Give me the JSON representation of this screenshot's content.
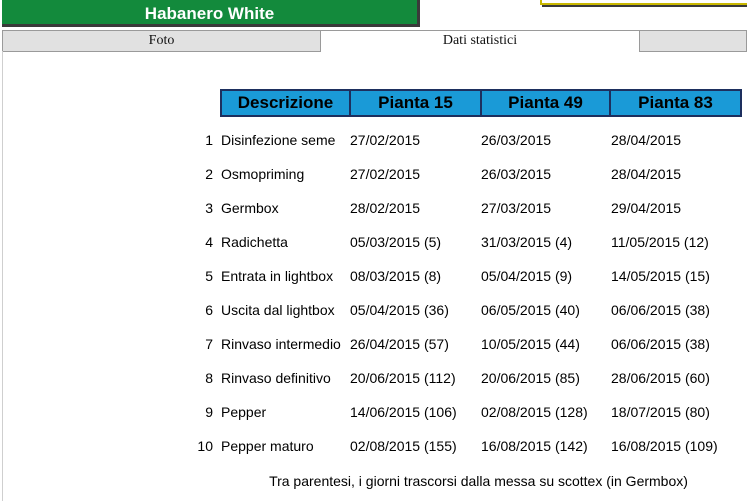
{
  "window": {
    "title": "Habanero White"
  },
  "tabs": [
    {
      "label": "Foto"
    },
    {
      "label": "Dati statistici"
    },
    {
      "label": ""
    }
  ],
  "table": {
    "headers": [
      "Descrizione",
      "Pianta 15",
      "Pianta 49",
      "Pianta 83"
    ],
    "rows": [
      {
        "n": "1",
        "desc": "Disinfezione seme",
        "p15": "27/02/2015",
        "p49": "26/03/2015",
        "p83": "28/04/2015"
      },
      {
        "n": "2",
        "desc": "Osmopriming",
        "p15": "27/02/2015",
        "p49": "26/03/2015",
        "p83": "28/04/2015"
      },
      {
        "n": "3",
        "desc": "Germbox",
        "p15": "28/02/2015",
        "p49": "27/03/2015",
        "p83": "29/04/2015"
      },
      {
        "n": "4",
        "desc": "Radichetta",
        "p15": "05/03/2015 (5)",
        "p49": "31/03/2015 (4)",
        "p83": "11/05/2015 (12)"
      },
      {
        "n": "5",
        "desc": "Entrata in lightbox",
        "p15": "08/03/2015 (8)",
        "p49": "05/04/2015 (9)",
        "p83": "14/05/2015 (15)"
      },
      {
        "n": "6",
        "desc": "Uscita dal lightbox",
        "p15": "05/04/2015 (36)",
        "p49": "06/05/2015 (40)",
        "p83": "06/06/2015 (38)"
      },
      {
        "n": "7",
        "desc": "Rinvaso intermedio",
        "p15": "26/04/2015 (57)",
        "p49": "10/05/2015 (44)",
        "p83": "06/06/2015 (38)"
      },
      {
        "n": "8",
        "desc": "Rinvaso definitivo",
        "p15": "20/06/2015 (112)",
        "p49": "20/06/2015 (85)",
        "p83": "28/06/2015 (60)"
      },
      {
        "n": "9",
        "desc": "Pepper",
        "p15": "14/06/2015 (106)",
        "p49": "02/08/2015 (128)",
        "p83": "18/07/2015 (80)"
      },
      {
        "n": "10",
        "desc": "Pepper maturo",
        "p15": "02/08/2015 (155)",
        "p49": "16/08/2015 (142)",
        "p83": "16/08/2015 (109)"
      }
    ]
  },
  "footnote": "Tra parentesi, i giorni trascorsi dalla messa su scottex (in Germbox)",
  "colors": {
    "title_bg": "#138a3c",
    "header_bg": "#1a9ad7",
    "header_border": "#1d2f5e",
    "tab_bg": "#e1e1e1"
  }
}
